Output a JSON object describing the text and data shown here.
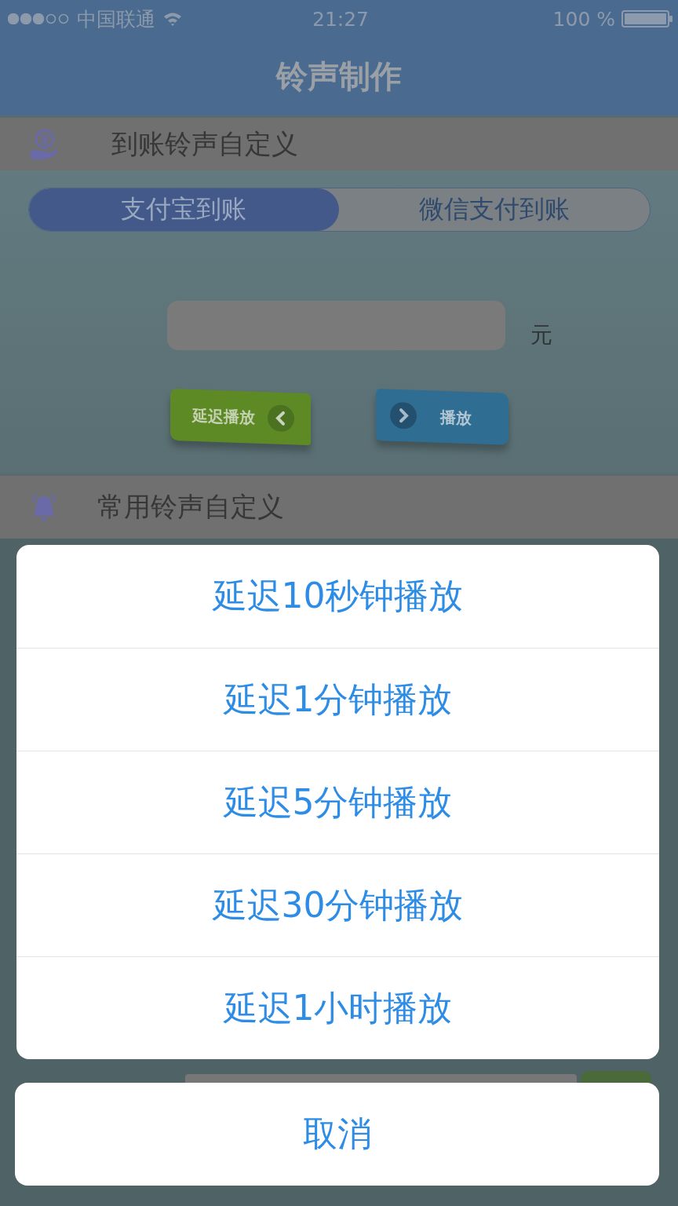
{
  "status_bar": {
    "carrier": "中国联通",
    "time": "21:27",
    "battery": "100 %"
  },
  "nav": {
    "title": "铃声制作"
  },
  "sections": [
    {
      "kind": "arrival",
      "title": "到账铃声自定义",
      "tabs": [
        {
          "label": "支付宝到账",
          "selected": true
        },
        {
          "label": "微信支付到账",
          "selected": false
        }
      ],
      "unit": "元",
      "buttons": [
        {
          "kind": "delay",
          "label": "延迟播放"
        },
        {
          "kind": "play",
          "label": "播放"
        }
      ]
    },
    {
      "kind": "common",
      "title": "常用铃声自定义"
    }
  ],
  "action_sheet": {
    "options": [
      "延迟10秒钟播放",
      "延迟1分钟播放",
      "延迟5分钟播放",
      "延迟30分钟播放",
      "延迟1小时播放"
    ],
    "cancel": "取消"
  }
}
